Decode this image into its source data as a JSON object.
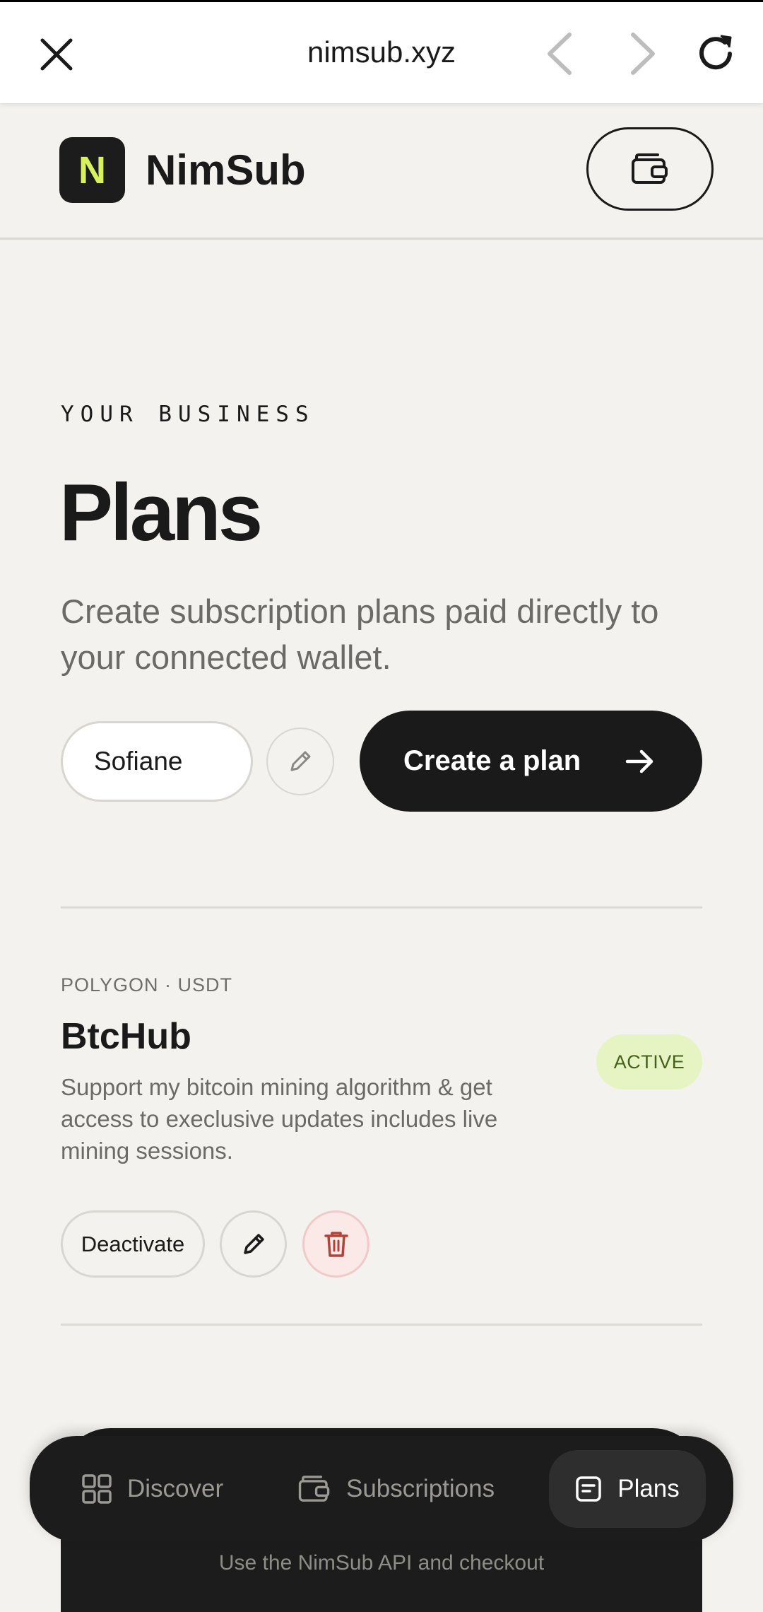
{
  "browser": {
    "url": "nimsub.xyz"
  },
  "app": {
    "brand_initial": "N",
    "brand_name": "NimSub"
  },
  "hero": {
    "eyebrow": "YOUR BUSINESS",
    "title": "Plans",
    "subtitle": "Create subscription plans paid directly to your connected wallet."
  },
  "business": {
    "name": "Sofiane",
    "create_label": "Create a plan"
  },
  "plans": [
    {
      "meta": "POLYGON · USDT",
      "name": "BtcHub",
      "status": "ACTIVE",
      "description": "Support my bitcoin mining algorithm & get access to execlusive updates includes live mining sessions.",
      "deactivate_label": "Deactivate"
    }
  ],
  "behind_card": {
    "peek_text": "Use the NimSub API and checkout"
  },
  "nav": {
    "items": [
      {
        "label": "Discover"
      },
      {
        "label": "Subscriptions"
      },
      {
        "label": "Plans"
      }
    ],
    "active": "Plans"
  },
  "colors": {
    "accent_lime": "#d7f25d",
    "dark": "#1a1a1a",
    "badge_bg": "#e6f4c4",
    "delete_red": "#b0443c"
  }
}
